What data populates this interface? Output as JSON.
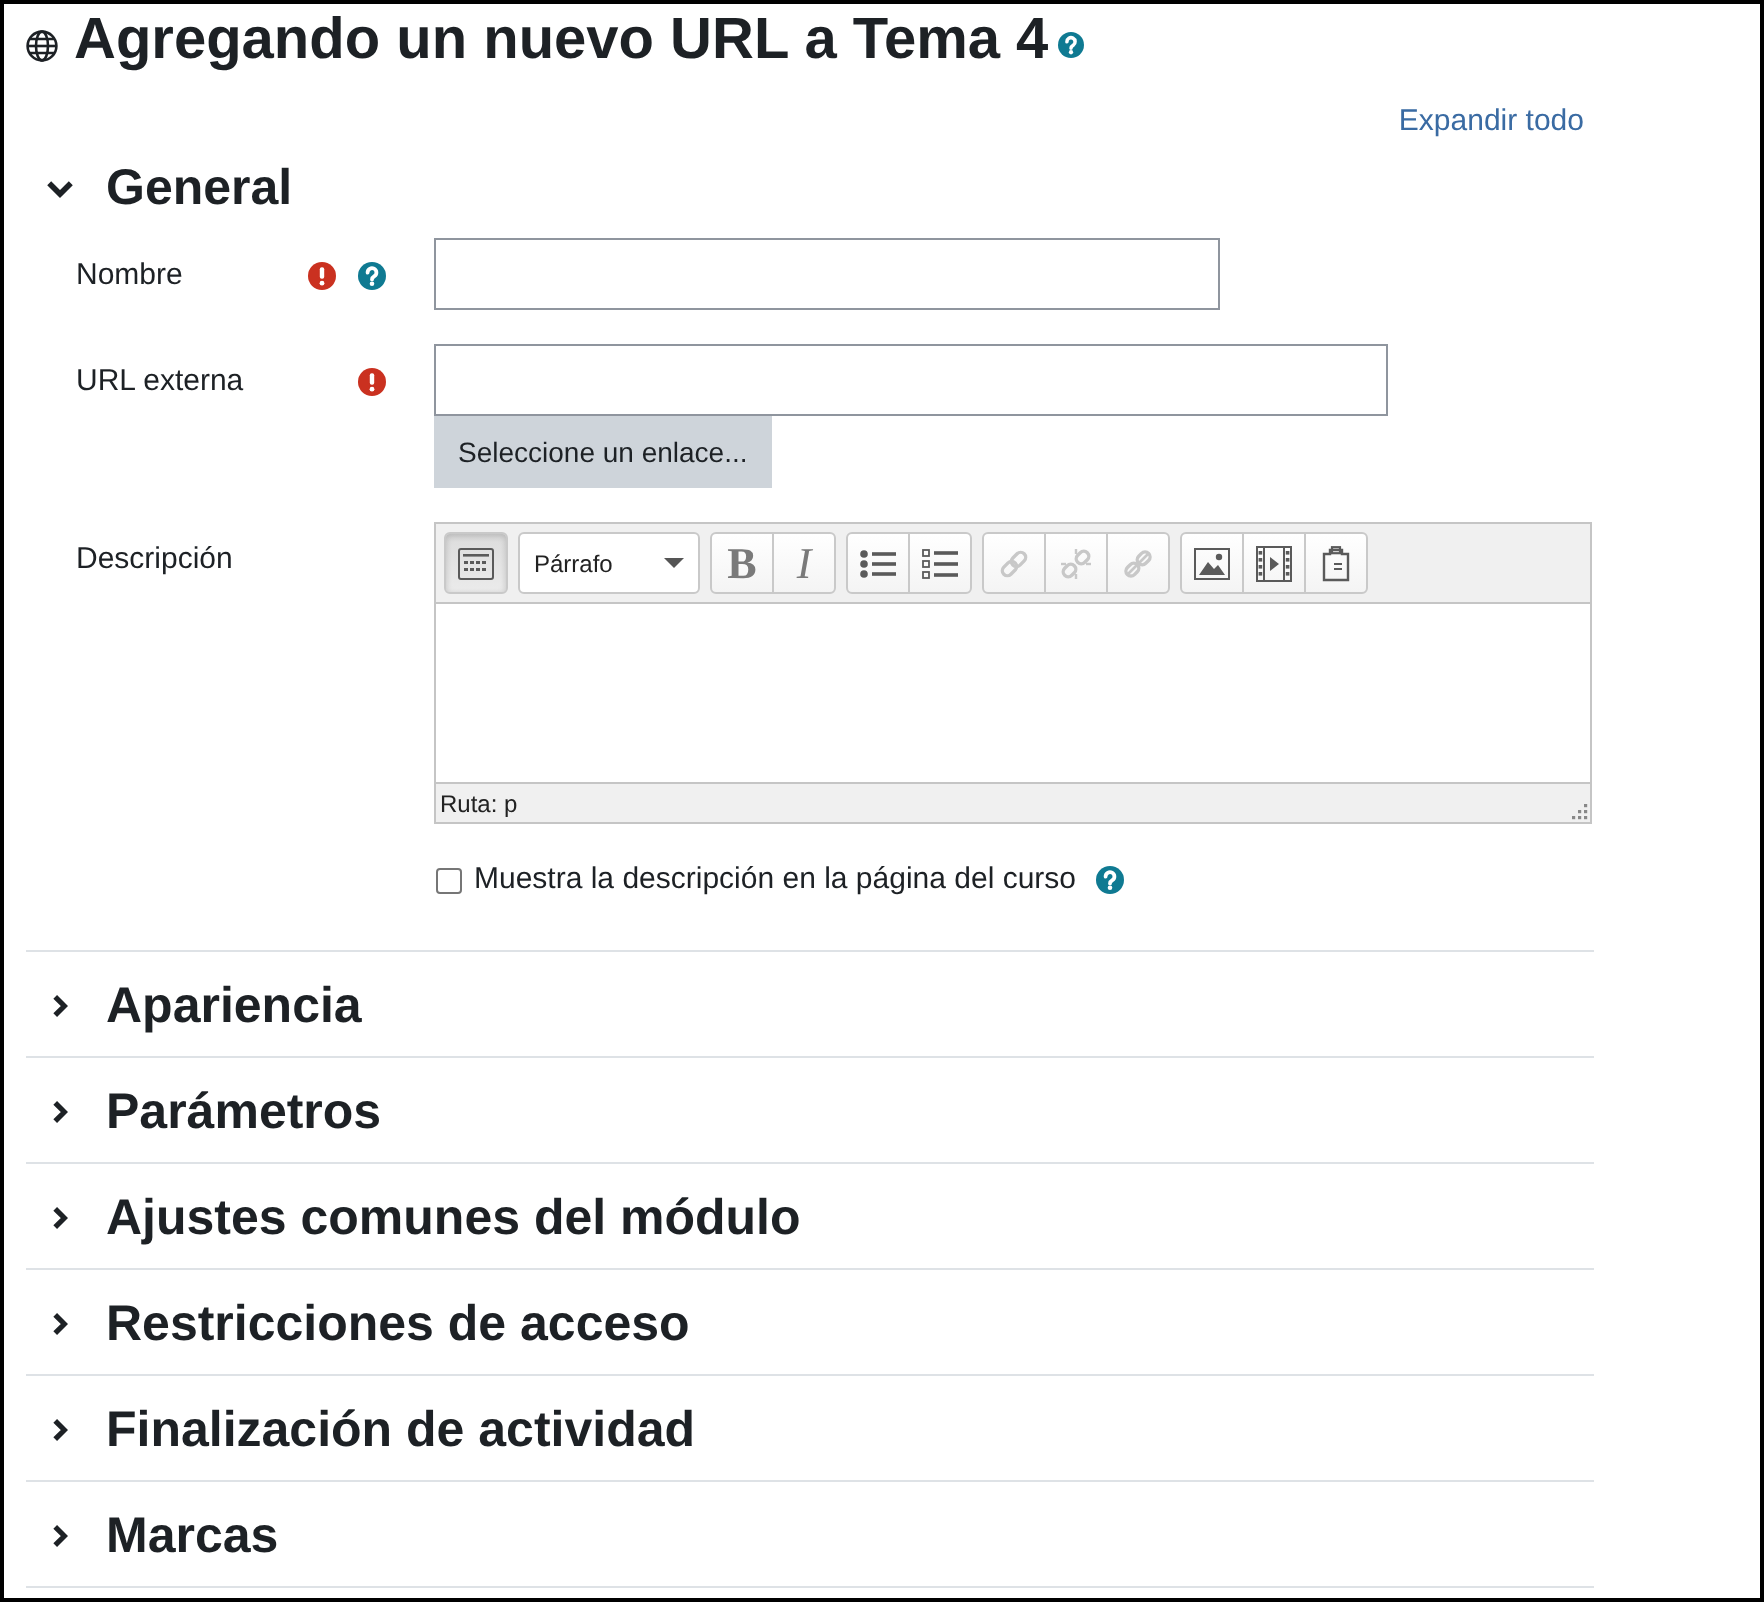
{
  "page": {
    "title": "Agregando un nuevo URL a Tema 4",
    "title_help": true,
    "expand_all": "Expandir todo"
  },
  "sections": [
    {
      "title": "General",
      "expanded": true,
      "fields": [
        {
          "kind": "text",
          "label": "Nombre",
          "required": true,
          "help": true
        },
        {
          "kind": "url",
          "label": "URL externa",
          "required": true,
          "help": false,
          "button": "Seleccione un enlace..."
        },
        {
          "kind": "editor",
          "label": "Descripción",
          "required": false,
          "help": false,
          "toolbar": [
            {
              "kind": "buttons",
              "buttons": [
                {
                  "kind": "toggle",
                  "pressed": true,
                  "disabled": false
                }
              ]
            },
            {
              "kind": "select",
              "value": "Párrafo"
            },
            {
              "kind": "buttons",
              "buttons": [
                {
                  "kind": "bold",
                  "label": "B",
                  "pressed": false,
                  "disabled": false
                },
                {
                  "kind": "italic",
                  "label": "I",
                  "pressed": false,
                  "disabled": false
                }
              ]
            },
            {
              "kind": "buttons",
              "buttons": [
                {
                  "kind": "bullet-list",
                  "pressed": false,
                  "disabled": false
                },
                {
                  "kind": "numbered-list",
                  "pressed": false,
                  "disabled": false
                }
              ]
            },
            {
              "kind": "buttons",
              "buttons": [
                {
                  "kind": "link",
                  "pressed": false,
                  "disabled": true
                },
                {
                  "kind": "unlink",
                  "pressed": false,
                  "disabled": true
                },
                {
                  "kind": "no-link",
                  "pressed": false,
                  "disabled": true
                }
              ]
            },
            {
              "kind": "buttons",
              "buttons": [
                {
                  "kind": "image",
                  "pressed": false,
                  "disabled": false
                },
                {
                  "kind": "media",
                  "pressed": false,
                  "disabled": false
                },
                {
                  "kind": "paste",
                  "pressed": false,
                  "disabled": false
                }
              ]
            }
          ],
          "path": "Ruta: p"
        },
        {
          "kind": "checkbox",
          "label": "Muestra la descripción en la página del curso",
          "checked": false,
          "help": true
        }
      ]
    },
    {
      "title": "Apariencia",
      "expanded": false
    },
    {
      "title": "Parámetros",
      "expanded": false
    },
    {
      "title": "Ajustes comunes del módulo",
      "expanded": false
    },
    {
      "title": "Restricciones de acceso",
      "expanded": false
    },
    {
      "title": "Finalización de actividad",
      "expanded": false
    },
    {
      "title": "Marcas",
      "expanded": false
    }
  ]
}
